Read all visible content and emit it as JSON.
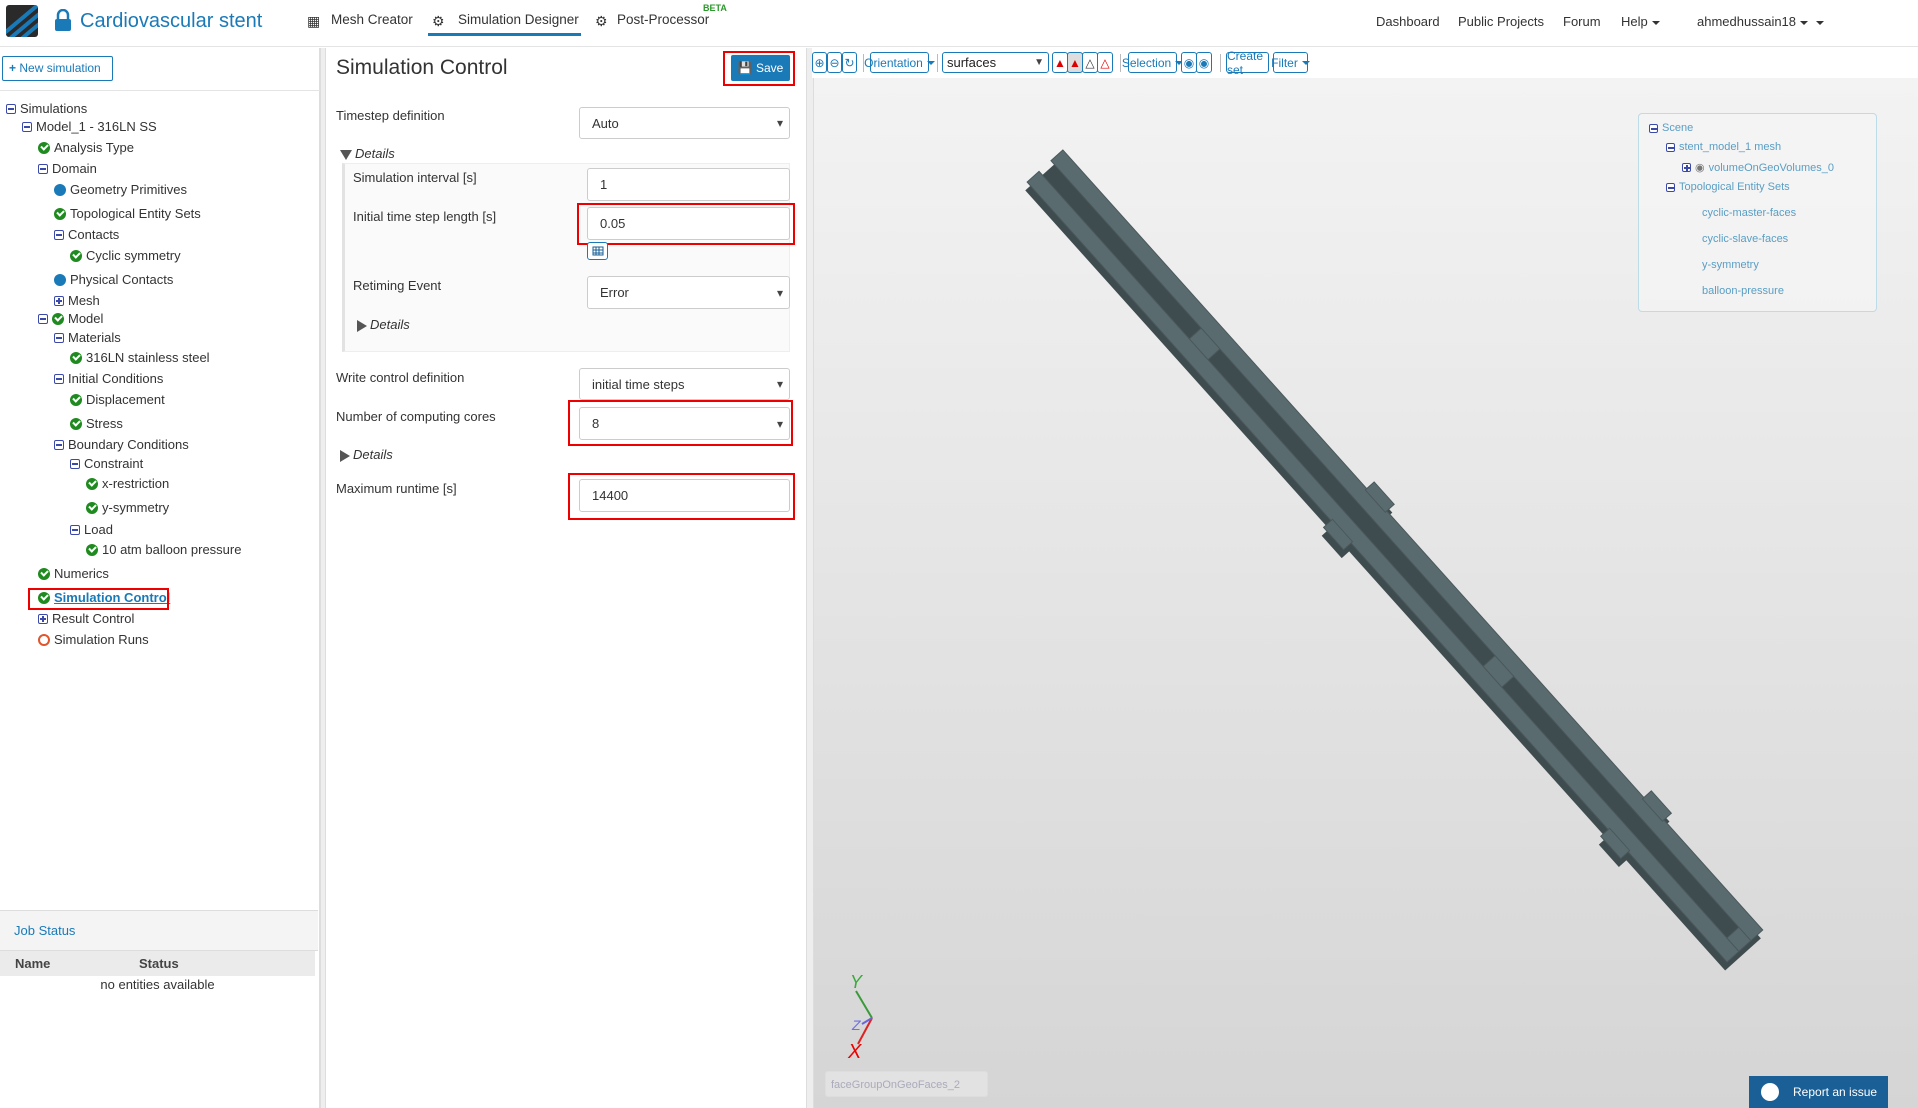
{
  "header": {
    "title": "Cardiovascular stent",
    "nav": [
      {
        "label": "Mesh Creator",
        "icon": "grid-icon"
      },
      {
        "label": "Simulation Designer",
        "icon": "gears-icon"
      },
      {
        "label": "Post-Processor",
        "icon": "gear-icon"
      }
    ],
    "beta": "BETA",
    "right_nav": [
      "Dashboard",
      "Public Projects",
      "Forum",
      "Help"
    ],
    "user": "ahmedhussain18"
  },
  "sidebar": {
    "new_simulation": "New simulation",
    "tree": [
      {
        "label": "Simulations",
        "icon": "minus"
      },
      {
        "label": "Model_1 - 316LN SS",
        "icon": "minus"
      },
      {
        "label": "Analysis Type",
        "icon": "check"
      },
      {
        "label": "Domain",
        "icon": "minus"
      },
      {
        "label": "Geometry Primitives",
        "icon": "dot"
      },
      {
        "label": "Topological Entity Sets",
        "icon": "check"
      },
      {
        "label": "Contacts",
        "icon": "minus"
      },
      {
        "label": "Cyclic symmetry",
        "icon": "check"
      },
      {
        "label": "Physical Contacts",
        "icon": "dot"
      },
      {
        "label": "Mesh",
        "icon": "plus"
      },
      {
        "label": "Model",
        "icon": "minus+check"
      },
      {
        "label": "Materials",
        "icon": "minus"
      },
      {
        "label": "316LN stainless steel",
        "icon": "check"
      },
      {
        "label": "Initial Conditions",
        "icon": "minus"
      },
      {
        "label": "Displacement",
        "icon": "check"
      },
      {
        "label": "Stress",
        "icon": "check"
      },
      {
        "label": "Boundary Conditions",
        "icon": "minus"
      },
      {
        "label": "Constraint",
        "icon": "minus"
      },
      {
        "label": "x-restriction",
        "icon": "check"
      },
      {
        "label": "y-symmetry",
        "icon": "check"
      },
      {
        "label": "Load",
        "icon": "minus"
      },
      {
        "label": "10 atm balloon pressure",
        "icon": "check"
      },
      {
        "label": "Numerics",
        "icon": "check"
      },
      {
        "label": "Simulation Control",
        "icon": "check",
        "selected": true
      },
      {
        "label": "Result Control",
        "icon": "plus"
      },
      {
        "label": "Simulation Runs",
        "icon": "ring"
      }
    ]
  },
  "job_status": {
    "title": "Job Status",
    "columns": [
      "Name",
      "Status"
    ],
    "empty": "no entities available"
  },
  "form": {
    "title": "Simulation Control",
    "save": "Save",
    "timestep_label": "Timestep definition",
    "timestep_value": "Auto",
    "details": "Details",
    "sim_interval_label": "Simulation interval [s]",
    "sim_interval_value": "1",
    "initial_step_label": "Initial time step length [s]",
    "initial_step_value": "0.05",
    "retiming_label": "Retiming Event",
    "retiming_value": "Error",
    "write_control_label": "Write control definition",
    "write_control_value": "initial time steps",
    "cores_label": "Number of computing cores",
    "cores_value": "8",
    "max_runtime_label": "Maximum runtime [s]",
    "max_runtime_value": "14400"
  },
  "toolbar": {
    "orientation": "Orientation",
    "render_select": "surfaces",
    "selection": "Selection",
    "create_set": "Create set",
    "filter": "Filter"
  },
  "scene": {
    "root": "Scene",
    "mesh": "stent_model_1 mesh",
    "volume": "volumeOnGeoVolumes_0",
    "sets_label": "Topological Entity Sets",
    "sets": [
      "cyclic-master-faces",
      "cyclic-slave-faces",
      "y-symmetry",
      "balloon-pressure"
    ]
  },
  "axes": {
    "x": "X",
    "y": "Y",
    "z": "Z"
  },
  "face_field": "faceGroupOnGeoFaces_2",
  "report": "Report an issue",
  "colors": {
    "accent": "#1a7ab8",
    "stent": "#56676b",
    "highlight": "#e00000"
  }
}
